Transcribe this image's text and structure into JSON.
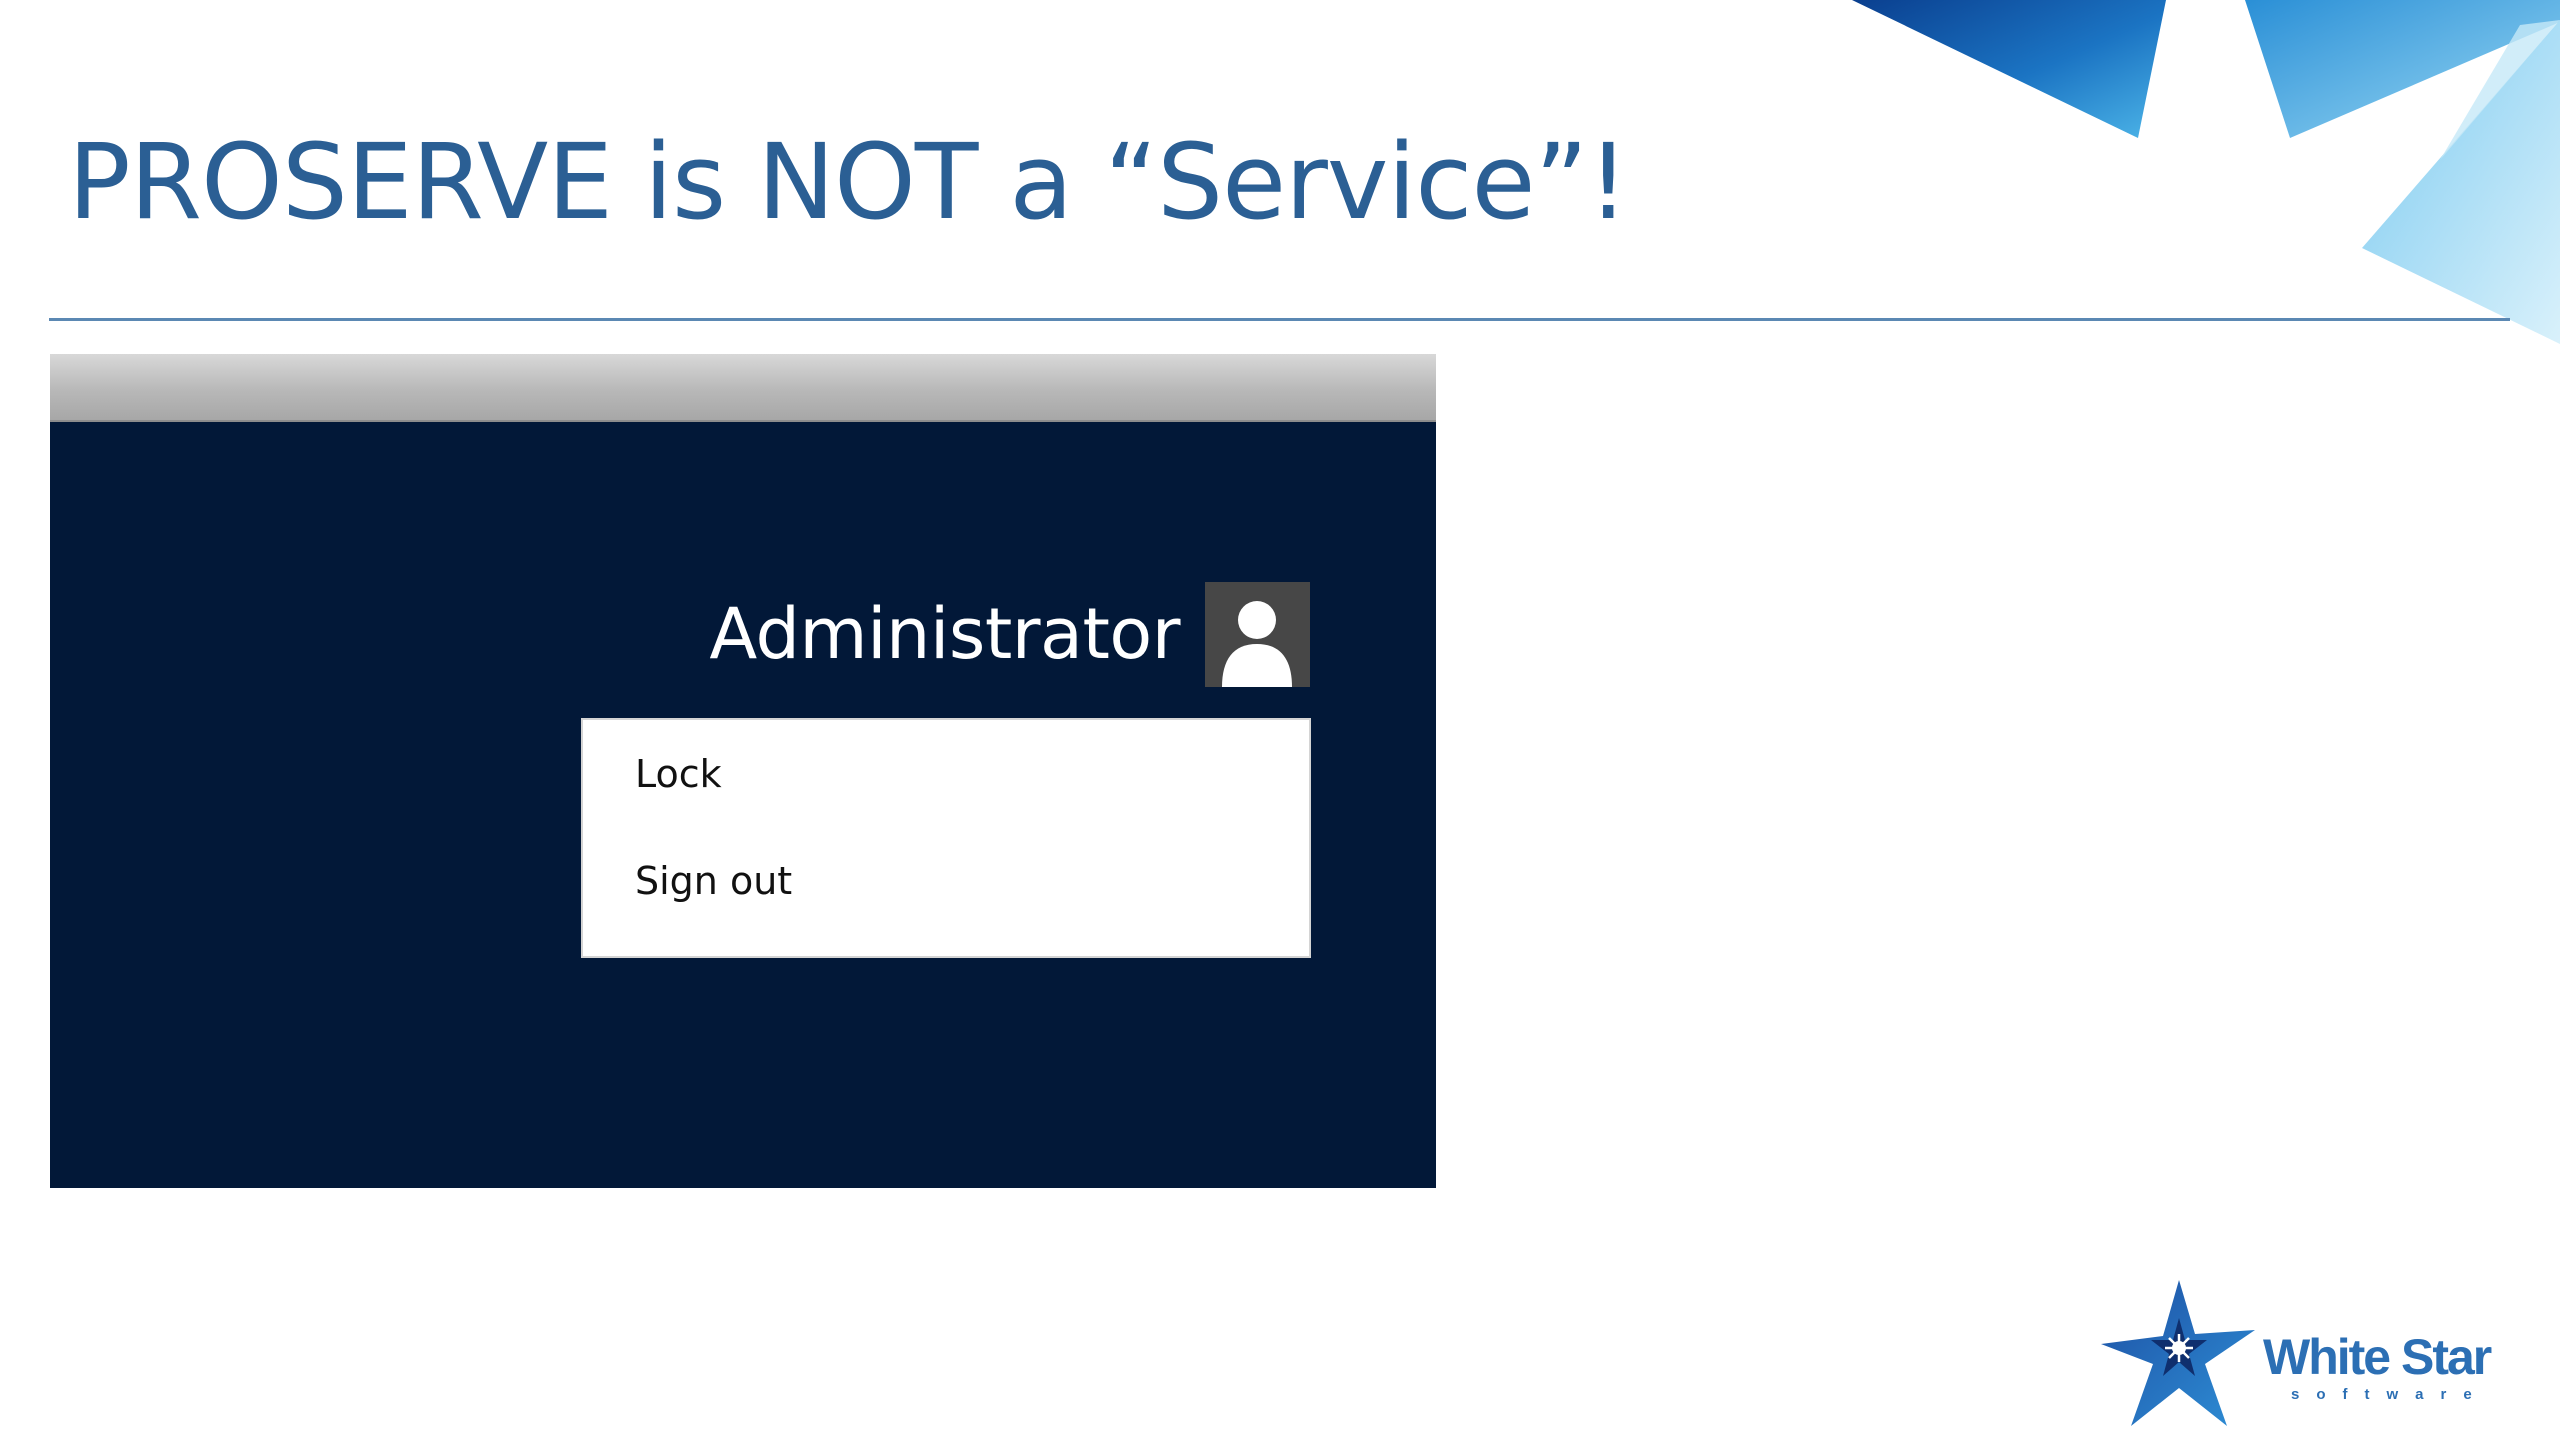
{
  "slide": {
    "title": "PROSERVE is NOT a “Service”!"
  },
  "screenshot": {
    "user_name": "Administrator",
    "avatar_icon": "user-avatar-icon",
    "menu": {
      "items": [
        {
          "label": "Lock"
        },
        {
          "label": "Sign out"
        }
      ]
    }
  },
  "brand": {
    "name": "White Star",
    "subtitle": "software",
    "star_icon": "white-star-logo-icon"
  },
  "colors": {
    "title": "#2b5f94",
    "rule": "#5b88b3",
    "screen_background": "#021838",
    "brand": "#2c6fb4"
  }
}
